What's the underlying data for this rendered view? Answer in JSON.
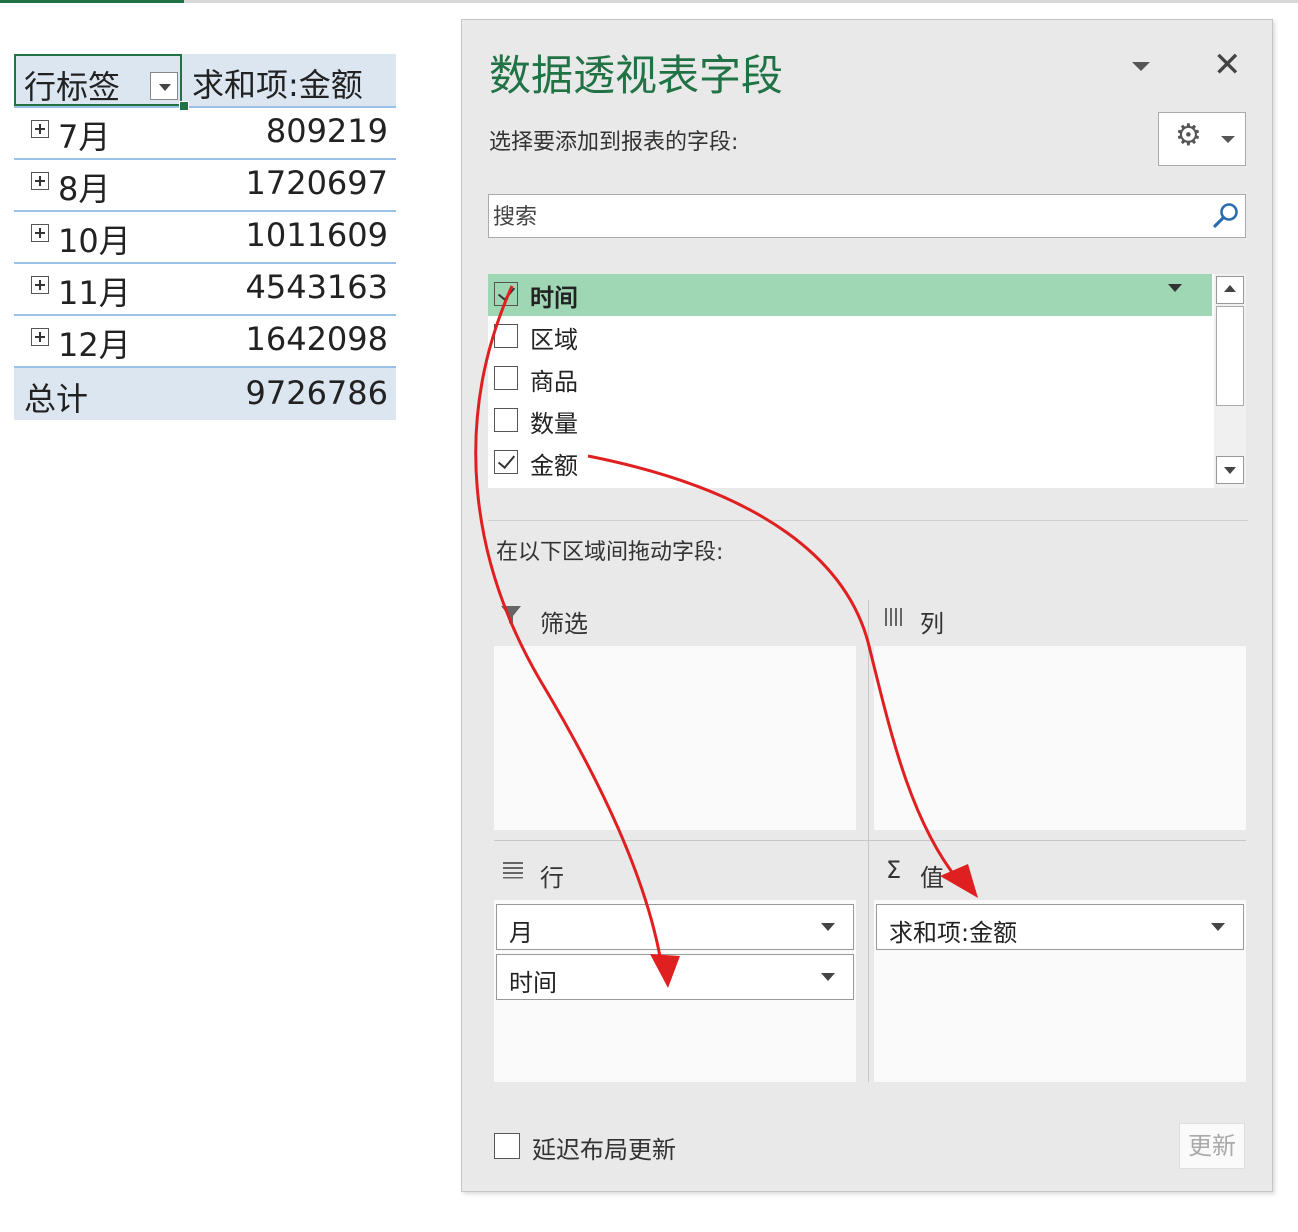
{
  "pivot": {
    "header_label": "行标签",
    "header_sum": "求和项:金额",
    "rows": [
      {
        "month": "7月",
        "value": "809219"
      },
      {
        "month": "8月",
        "value": "1720697"
      },
      {
        "month": "10月",
        "value": "1011609"
      },
      {
        "month": "11月",
        "value": "4543163"
      },
      {
        "month": "12月",
        "value": "1642098"
      }
    ],
    "total_label": "总计",
    "total_value": "9726786"
  },
  "panel": {
    "title": "数据透视表字段",
    "close_glyph": "✕",
    "choose_fields": "选择要添加到报表的字段:",
    "search_placeholder": "搜索",
    "fields": [
      {
        "name": "时间",
        "checked": true,
        "selected": true
      },
      {
        "name": "区域",
        "checked": false,
        "selected": false
      },
      {
        "name": "商品",
        "checked": false,
        "selected": false
      },
      {
        "name": "数量",
        "checked": false,
        "selected": false
      },
      {
        "name": "金额",
        "checked": true,
        "selected": false
      }
    ],
    "drag_hint": "在以下区域间拖动字段:",
    "areas": {
      "filter": {
        "label": "筛选",
        "items": []
      },
      "columns": {
        "label": "列",
        "items": []
      },
      "rows": {
        "label": "行",
        "items": [
          "月",
          "时间"
        ]
      },
      "values": {
        "label": "值",
        "icon_glyph": "Σ",
        "items": [
          "求和项:金额"
        ]
      }
    },
    "defer_update": "延迟布局更新",
    "update_button": "更新"
  },
  "colors": {
    "accent": "#217346",
    "selected_field": "#9fd6b4",
    "pivot_header": "#dce6f1",
    "pivot_line": "#9bc2e6",
    "arrow": "#e02020"
  }
}
